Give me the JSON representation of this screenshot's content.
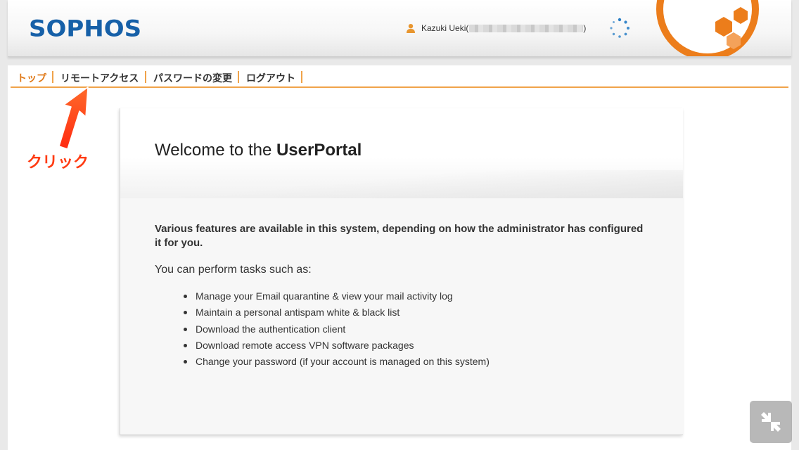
{
  "header": {
    "logo": "SOPHOS",
    "user_label": "Kazuki Ueki(",
    "user_suffix": ")",
    "user_icon": "person-icon",
    "spinner_icon": "loading-spinner-icon",
    "emblem_icon": "sophos-emblem-icon"
  },
  "nav": {
    "items": [
      {
        "label": "トップ",
        "active": true
      },
      {
        "label": "リモートアクセス",
        "active": false
      },
      {
        "label": "パスワードの変更",
        "active": false
      },
      {
        "label": "ログアウト",
        "active": false
      }
    ]
  },
  "main": {
    "welcome_prefix": "Welcome to the ",
    "welcome_bold": "UserPortal",
    "intro": "Various features are available in this system, depending on how the administrator has configured it for you.",
    "tasks_title": "You can perform tasks such as:",
    "tasks": [
      "Manage your Email quarantine & view your mail activity log",
      "Maintain a personal antispam white & black list",
      "Download the authentication client",
      "Download remote access VPN software packages",
      "Change your password (if your account is managed on this system)"
    ]
  },
  "annotation": {
    "label": "クリック",
    "arrow_icon": "red-arrow-icon"
  },
  "overlay": {
    "exit_fullscreen_icon": "exit-fullscreen-icon"
  },
  "colors": {
    "brand_blue": "#1660a8",
    "accent_orange": "#f0a34a",
    "active_nav": "#e07a1a",
    "annotation_red": "#ff3b12"
  }
}
